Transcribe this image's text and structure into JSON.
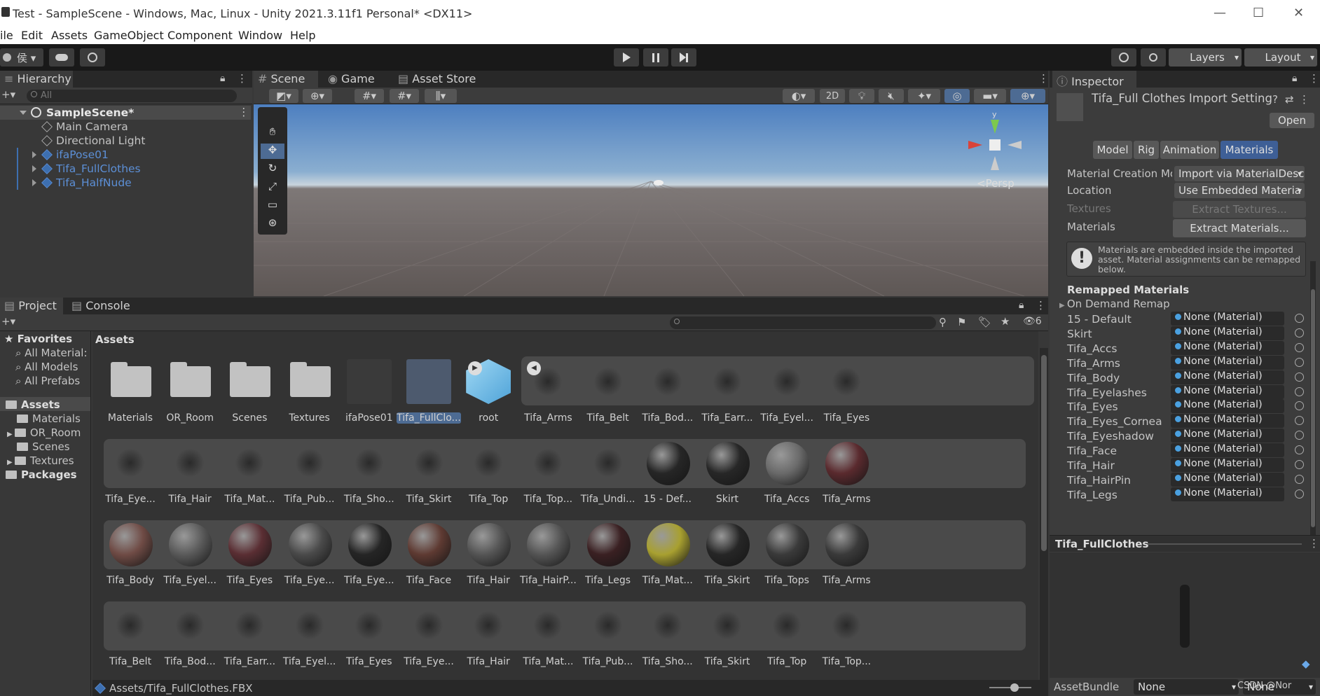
{
  "window": {
    "title": "Test - SampleScene - Windows, Mac, Linux - Unity 2021.3.11f1 Personal* <DX11>",
    "minimize": "—",
    "maximize": "☐",
    "close": "✕"
  },
  "menu": [
    "ile",
    "Edit",
    "Assets",
    "GameObject",
    "Component",
    "Window",
    "Help"
  ],
  "toolbar": {
    "account": "侯 ▾",
    "layers": "Layers",
    "layout": "Layout"
  },
  "hierarchy": {
    "tab": "Hierarchy",
    "search_placeholder": "All",
    "scene": "SampleScene*",
    "items": [
      "Main Camera",
      "Directional Light",
      "ifaPose01",
      "Tifa_FullClothes",
      "Tifa_HalfNude"
    ]
  },
  "scene_tabs": {
    "scene": "Scene",
    "game": "Game",
    "store": "Asset Store"
  },
  "scene_view": {
    "mode_2d": "2D",
    "persp": "<Persp",
    "gizmo_y": "y"
  },
  "project": {
    "tabs": {
      "project": "Project",
      "console": "Console"
    },
    "hidden_count": "6",
    "favorites_label": "Favorites",
    "favorites": [
      "All Material:",
      "All Models",
      "All Prefabs"
    ],
    "assets_label": "Assets",
    "asset_folders": [
      "Materials",
      "OR_Room",
      "Scenes",
      "Textures"
    ],
    "packages_label": "Packages",
    "breadcrumb": "Assets",
    "path": "Assets/Tifa_FullClothes.FBX",
    "grid_row1": [
      "Materials",
      "OR_Room",
      "Scenes",
      "Textures",
      "ifaPose01",
      "Tifa_FullClo...",
      "root",
      "Tifa_Arms",
      "Tifa_Belt",
      "Tifa_Bod...",
      "Tifa_Earr...",
      "Tifa_Eyel...",
      "Tifa_Eyes"
    ],
    "grid_row2": [
      "Tifa_Eye...",
      "Tifa_Hair",
      "Tifa_Mat...",
      "Tifa_Pub...",
      "Tifa_Sho...",
      "Tifa_Skirt",
      "Tifa_Top",
      "Tifa_Top...",
      "Tifa_Undi...",
      "15 - Def...",
      "Skirt",
      "Tifa_Accs",
      "Tifa_Arms"
    ],
    "grid_row3": [
      "Tifa_Body",
      "Tifa_Eyel...",
      "Tifa_Eyes",
      "Tifa_Eye...",
      "Tifa_Eye...",
      "Tifa_Face",
      "Tifa_Hair",
      "Tifa_HairP...",
      "Tifa_Legs",
      "Tifa_Mat...",
      "Tifa_Skirt",
      "Tifa_Tops",
      "Tifa_Arms"
    ],
    "grid_row4": [
      "Tifa_Belt",
      "Tifa_Bod...",
      "Tifa_Earr...",
      "Tifa_Eyel...",
      "Tifa_Eyes",
      "Tifa_Eye...",
      "Tifa_Hair",
      "Tifa_Mat...",
      "Tifa_Pub...",
      "Tifa_Sho...",
      "Tifa_Skirt",
      "Tifa_Top",
      "Tifa_Top..."
    ]
  },
  "inspector": {
    "tab": "Inspector",
    "title": "Tifa_Full Clothes Import Setting",
    "open": "Open",
    "subtabs": [
      "Model",
      "Rig",
      "Animation",
      "Materials"
    ],
    "material_creation_label": "Material Creation Mc",
    "material_creation_value": "Import via MaterialDesc",
    "location_label": "Location",
    "location_value": "Use Embedded Materia",
    "textures_label": "Textures",
    "extract_textures": "Extract Textures...",
    "materials_label": "Materials",
    "extract_materials": "Extract Materials...",
    "info": "Materials are embedded inside the imported asset. Material assignments can be remapped below.",
    "remapped_header": "Remapped Materials",
    "on_demand": "On Demand Remap",
    "none_value": "None (Material)",
    "remaps": [
      "15 - Default",
      "Skirt",
      "Tifa_Accs",
      "Tifa_Arms",
      "Tifa_Body",
      "Tifa_Eyelashes",
      "Tifa_Eyes",
      "Tifa_Eyes_Cornea",
      "Tifa_Eyeshadow",
      "Tifa_Face",
      "Tifa_Hair",
      "Tifa_HairPin",
      "Tifa_Legs"
    ],
    "preview_title": "Tifa_FullClothes",
    "assetbundle_label": "AssetBundle",
    "assetbundle_value": "None",
    "assetbundle_variant": "None",
    "watermark": "CSDN @Nor"
  },
  "colors": {
    "accent": "#3e5f96",
    "selected": "#4d6b93",
    "blue_text": "#5c8fd6"
  }
}
